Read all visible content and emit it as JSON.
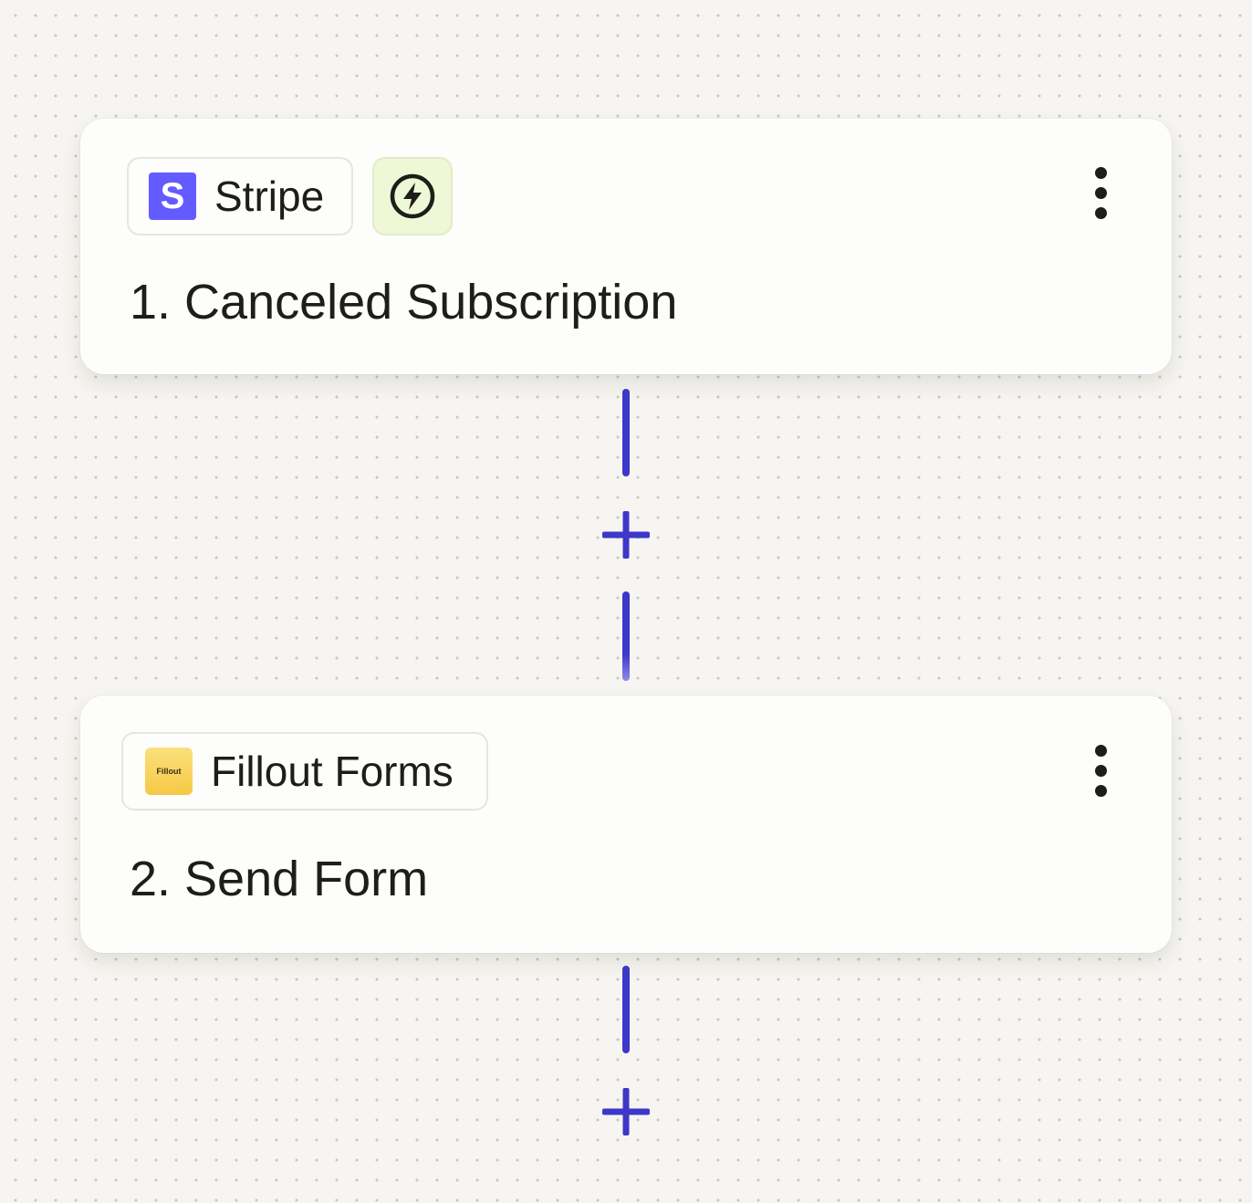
{
  "steps": [
    {
      "app_name": "Stripe",
      "app_logo_letter": "S",
      "app_icon": "stripe-logo",
      "trigger_icon": "lightning-bolt-icon",
      "title": "1. Canceled Subscription",
      "menu_icon": "vertical-dots-icon"
    },
    {
      "app_name": "Fillout Forms",
      "app_logo_text": "Fillout",
      "app_icon": "fillout-logo",
      "title": "2. Send Form",
      "menu_icon": "vertical-dots-icon"
    }
  ],
  "add_step_icon": "plus-icon",
  "colors": {
    "connector": "#3d38c9",
    "stripe": "#635bff",
    "fillout": "#f6c945",
    "trigger_bg": "#eef7d6",
    "card_bg": "#fdfdfb",
    "canvas_bg": "#f6f5f1"
  }
}
